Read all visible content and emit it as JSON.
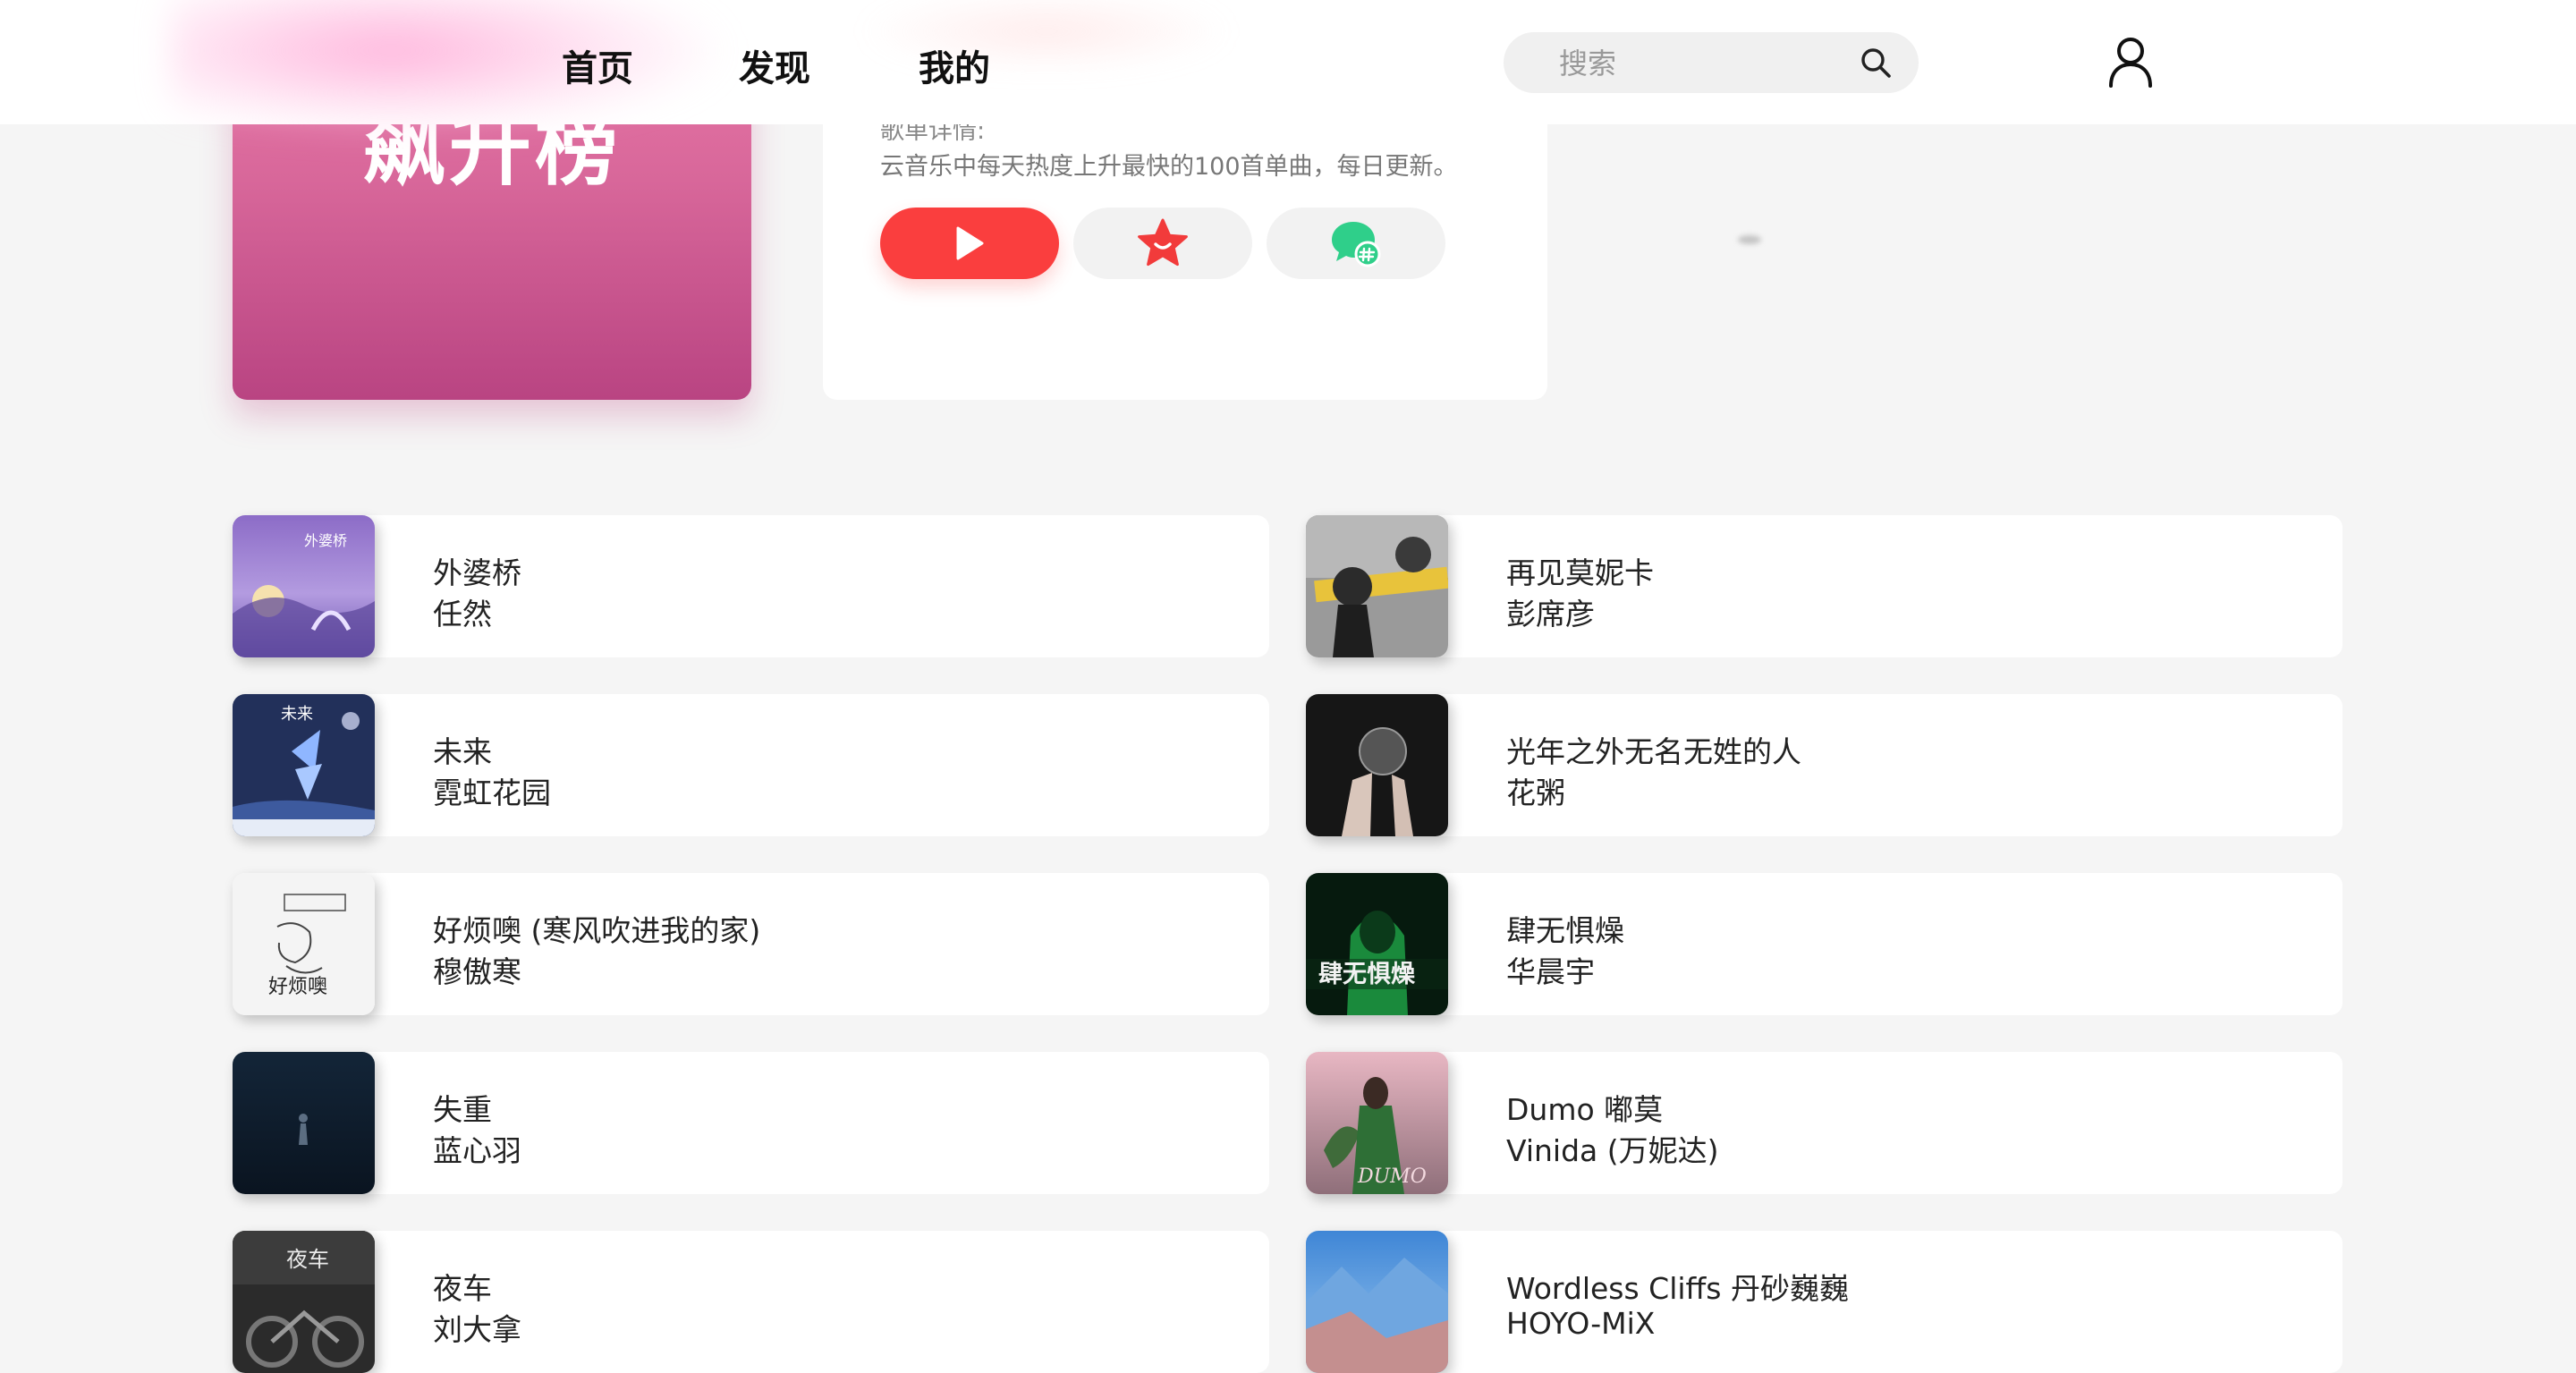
{
  "nav": {
    "home": "首页",
    "discover": "发现",
    "mine": "我的"
  },
  "search": {
    "placeholder": "搜索"
  },
  "playlist": {
    "cover_title": "飙升榜",
    "desc_label": "歌单详情:",
    "description": "云音乐中每天热度上升最快的100首单曲，每日更新。"
  },
  "colors": {
    "accent": "#fa3e3e",
    "cover_gradient_top": "#ea79a8",
    "cover_gradient_bottom": "#b94482",
    "comment_green": "#2fcf8a"
  },
  "songs": [
    {
      "title": "外婆桥",
      "artist": "任然",
      "cover_art": "lavender-lake-bridge",
      "cover_text": "外婆桥"
    },
    {
      "title": "再见莫妮卡",
      "artist": "彭席彦",
      "cover_art": "grey-portrait-yellow-stripe",
      "cover_text": ""
    },
    {
      "title": "未来",
      "artist": "霓虹花园",
      "cover_art": "blue-butterfly-night",
      "cover_text": "未来"
    },
    {
      "title": "光年之外无名无姓的人",
      "artist": "花粥",
      "cover_art": "dark-hands-orb",
      "cover_text": ""
    },
    {
      "title": "好烦噢 (寒风吹进我的家)",
      "artist": "穆傲寒",
      "cover_art": "white-sketch",
      "cover_text": "好烦噢"
    },
    {
      "title": "肆无惧燥",
      "artist": "华晨宇",
      "cover_art": "green-hooded-figure",
      "cover_text": "肆无惧燥"
    },
    {
      "title": "失重",
      "artist": "蓝心羽",
      "cover_art": "dark-navy-figure",
      "cover_text": ""
    },
    {
      "title": "Dumo 嘟莫",
      "artist": "Vinida (万妮达)",
      "cover_art": "green-dress-pink-sky",
      "cover_text": "DUMO"
    },
    {
      "title": "夜车",
      "artist": "刘大拿",
      "cover_art": "night-motorbike",
      "cover_text": "夜车"
    },
    {
      "title": "Wordless Cliffs 丹砂巍巍",
      "artist": "HOYO-MiX",
      "cover_art": "blue-cliffs",
      "cover_text": ""
    }
  ]
}
